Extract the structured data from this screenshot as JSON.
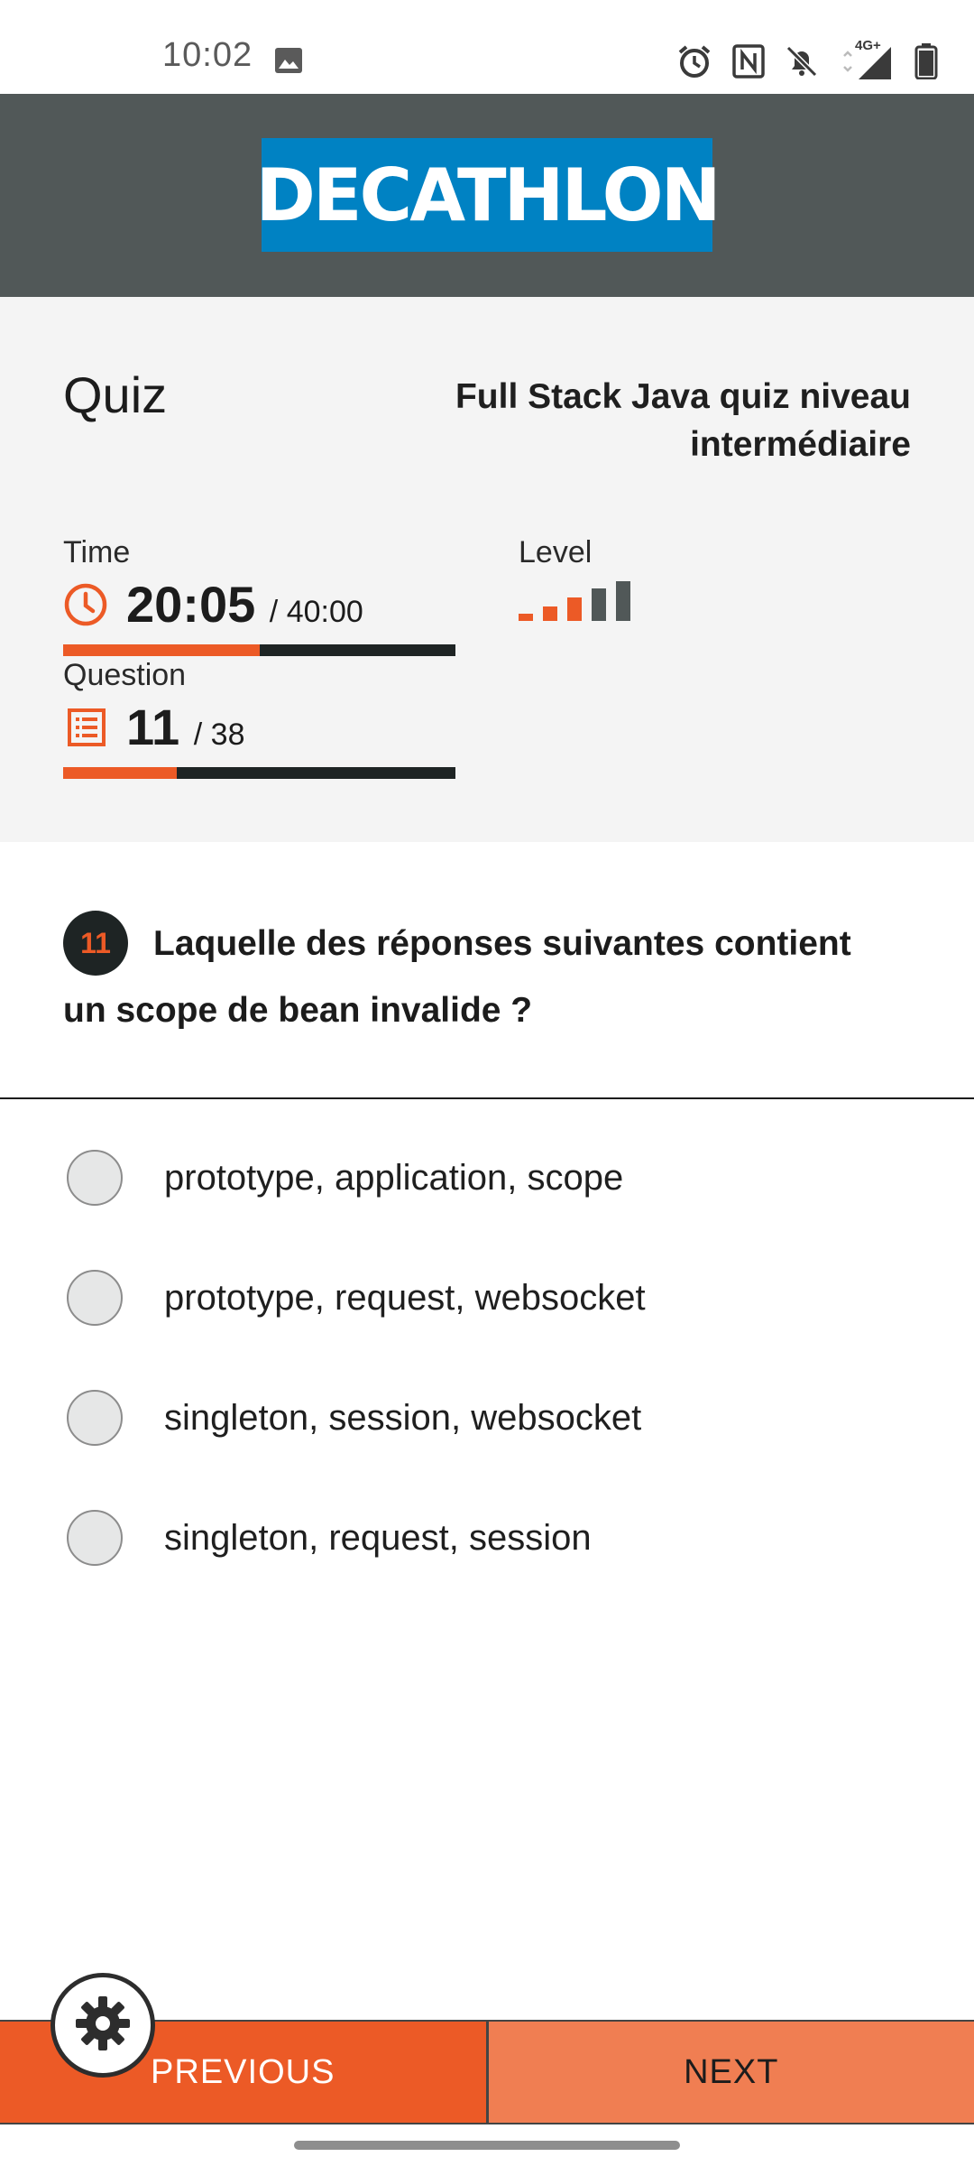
{
  "status_bar": {
    "time": "10:02",
    "icons": [
      "image-icon",
      "alarm-icon",
      "nfc-icon",
      "bell-off-icon",
      "signal-4g-icon",
      "battery-icon"
    ],
    "network_label": "4G+"
  },
  "header": {
    "brand": "DECATHLON",
    "brand_color": "#0082c3",
    "background_color": "#515858"
  },
  "quiz": {
    "title": "Quiz",
    "name": "Full Stack Java quiz niveau intermédiaire"
  },
  "time": {
    "label": "Time",
    "current": "20:05",
    "total": "/ 40:00",
    "progress_fraction": 0.5
  },
  "question_progress": {
    "label": "Question",
    "current": "11",
    "total": "/ 38",
    "progress_fraction": 0.29
  },
  "level": {
    "label": "Level",
    "active_bars": 3,
    "total_bars": 5
  },
  "question": {
    "number": "11",
    "text": "Laquelle des réponses suivantes contient un scope de bean invalide ?"
  },
  "answers": [
    {
      "label": "prototype, application, scope",
      "selected": false
    },
    {
      "label": "prototype, request, websocket",
      "selected": false
    },
    {
      "label": "singleton, session, websocket",
      "selected": false
    },
    {
      "label": "singleton, request, session",
      "selected": false
    }
  ],
  "nav": {
    "previous": "PREVIOUS",
    "next": "NEXT"
  },
  "colors": {
    "accent": "#ec5a26",
    "accent_light": "#f07e52",
    "dark": "#1e2424"
  }
}
